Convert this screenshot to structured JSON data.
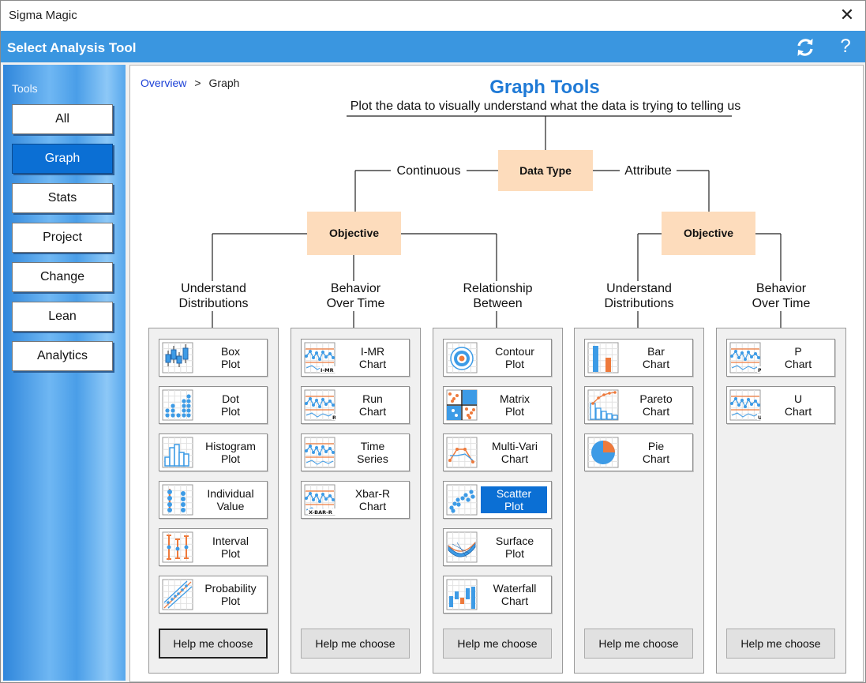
{
  "window": {
    "title": "Sigma Magic"
  },
  "header": {
    "title": "Select Analysis Tool"
  },
  "sidebar": {
    "title": "Tools",
    "items": [
      {
        "label": "All",
        "active": false
      },
      {
        "label": "Graph",
        "active": true
      },
      {
        "label": "Stats",
        "active": false
      },
      {
        "label": "Project",
        "active": false
      },
      {
        "label": "Change",
        "active": false
      },
      {
        "label": "Lean",
        "active": false
      },
      {
        "label": "Analytics",
        "active": false
      }
    ]
  },
  "breadcrumb": {
    "link": "Overview",
    "separator": ">",
    "current": "Graph"
  },
  "main": {
    "title": "Graph Tools",
    "subtitle": "Plot the data to visually understand what the data is trying to telling us",
    "data_type": "Data Type",
    "continuous": "Continuous",
    "attribute": "Attribute",
    "objective_left": "Objective",
    "objective_right": "Objective"
  },
  "categories": [
    {
      "label1": "Understand",
      "label2": "Distributions",
      "tools": [
        {
          "line1": "Box",
          "line2": "Plot",
          "icon": "box-plot-icon"
        },
        {
          "line1": "Dot",
          "line2": "Plot",
          "icon": "dot-plot-icon"
        },
        {
          "line1": "Histogram",
          "line2": "Plot",
          "icon": "histogram-icon"
        },
        {
          "line1": "Individual",
          "line2": "Value",
          "icon": "individual-value-icon"
        },
        {
          "line1": "Interval",
          "line2": "Plot",
          "icon": "interval-plot-icon"
        },
        {
          "line1": "Probability",
          "line2": "Plot",
          "icon": "probability-plot-icon"
        }
      ],
      "help": "Help me choose"
    },
    {
      "label1": "Behavior",
      "label2": "Over Time",
      "tools": [
        {
          "line1": "I-MR",
          "line2": "Chart",
          "icon": "imr-chart-icon"
        },
        {
          "line1": "Run",
          "line2": "Chart",
          "icon": "run-chart-icon"
        },
        {
          "line1": "Time",
          "line2": "Series",
          "icon": "time-series-icon"
        },
        {
          "line1": "Xbar-R",
          "line2": "Chart",
          "icon": "xbar-r-chart-icon"
        }
      ],
      "help": "Help me choose"
    },
    {
      "label1": "Relationship",
      "label2": "Between",
      "tools": [
        {
          "line1": "Contour",
          "line2": "Plot",
          "icon": "contour-plot-icon"
        },
        {
          "line1": "Matrix",
          "line2": "Plot",
          "icon": "matrix-plot-icon"
        },
        {
          "line1": "Multi-Vari",
          "line2": "Chart",
          "icon": "multi-vari-icon"
        },
        {
          "line1": "Scatter",
          "line2": "Plot",
          "icon": "scatter-plot-icon",
          "selected": true
        },
        {
          "line1": "Surface",
          "line2": "Plot",
          "icon": "surface-plot-icon"
        },
        {
          "line1": "Waterfall",
          "line2": "Chart",
          "icon": "waterfall-chart-icon"
        }
      ],
      "help": "Help me choose"
    },
    {
      "label1": "Understand",
      "label2": "Distributions",
      "tools": [
        {
          "line1": "Bar",
          "line2": "Chart",
          "icon": "bar-chart-icon"
        },
        {
          "line1": "Pareto",
          "line2": "Chart",
          "icon": "pareto-chart-icon"
        },
        {
          "line1": "Pie",
          "line2": "Chart",
          "icon": "pie-chart-icon"
        }
      ],
      "help": "Help me choose"
    },
    {
      "label1": "Behavior",
      "label2": "Over Time",
      "tools": [
        {
          "line1": "P",
          "line2": "Chart",
          "icon": "p-chart-icon"
        },
        {
          "line1": "U",
          "line2": "Chart",
          "icon": "u-chart-icon"
        }
      ],
      "help": "Help me choose"
    }
  ],
  "icon_tags": {
    "imr": "I-MR",
    "run": "R",
    "xbar": "X-BAR-R",
    "p": "P",
    "u": "U"
  },
  "colors": {
    "accent": "#3a96e0",
    "selected": "#0b6fd4",
    "node": "#fddcbc",
    "blue_mark": "#3d9be6",
    "orange_mark": "#ee7a3c"
  }
}
